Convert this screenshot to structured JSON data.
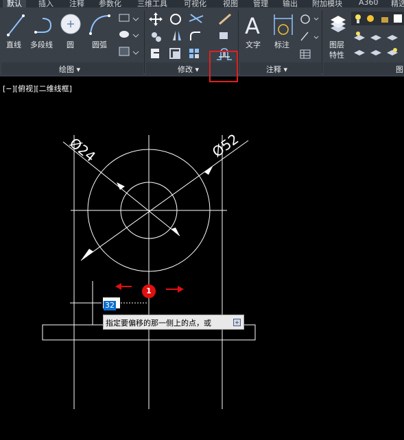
{
  "tabs": [
    "默认",
    "插入",
    "注释",
    "参数化",
    "三维工具",
    "可视化",
    "视图",
    "管理",
    "输出",
    "附加模块",
    "A360",
    "精选"
  ],
  "draw_panel": {
    "line_label": "直线",
    "polyline_label": "多段线",
    "circle_label": "圆",
    "arc_label": "圆弧",
    "panel_title": "绘图 ▾"
  },
  "modify_panel": {
    "panel_title": "修改 ▾"
  },
  "annotation_panel": {
    "text_label": "文字",
    "dimension_label": "标注",
    "panel_title": "注释 ▾"
  },
  "layers_panel": {
    "layer_props_label_1": "图层",
    "layer_props_label_2": "特性",
    "panel_title": "图"
  },
  "viewport": {
    "label": "[−][俯视][二维线框]"
  },
  "drawing": {
    "dim_small": "Ø24",
    "dim_large": "Ø52"
  },
  "dynamic_input": {
    "value": "32"
  },
  "prompt": {
    "text": "指定要偏移的那一侧上的点，或",
    "button": "+"
  },
  "badge": {
    "number": "1"
  },
  "colors": {
    "accent_red": "#e02020",
    "ribbon_bg": "#3a4048",
    "canvas_bg": "#000000"
  }
}
